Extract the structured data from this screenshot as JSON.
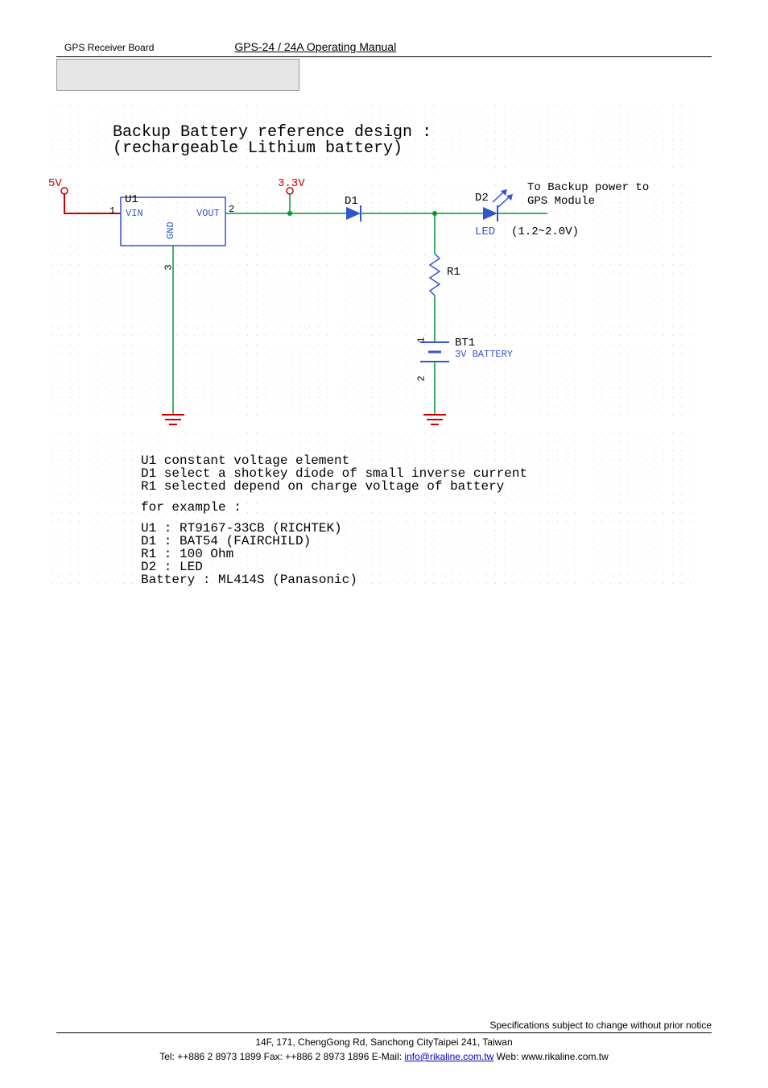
{
  "header": {
    "left": "GPS Receiver Board",
    "center": "GPS-24 / 24A Operating Manual"
  },
  "schematic": {
    "title1": "Backup Battery reference design :",
    "title2": "(rechargeable Lithium battery)",
    "v5": "5V",
    "v33": "3.3V",
    "U1": "U1",
    "VIN": "VIN",
    "VOUT": "VOUT",
    "GND": "GND",
    "pin1": "1",
    "pin2": "2",
    "pin3": "3",
    "D1": "D1",
    "D2": "D2",
    "LED": "LED",
    "ledv": "(1.2~2.0V)",
    "R1": "R1",
    "BT1": "BT1",
    "BT1desc": "3V BATTERY",
    "bt_pin1": "1",
    "bt_pin2": "2",
    "out1": "To Backup power to",
    "out2": "GPS Module",
    "notes_u1": "U1 constant voltage element",
    "notes_d1": "D1 select a shotkey diode of small inverse current",
    "notes_r1": "R1 selected depend on charge voltage of battery",
    "for_example": "for example :",
    "ex_u1": "U1 : RT9167-33CB (RICHTEK)",
    "ex_d1": "D1 : BAT54 (FAIRCHILD)",
    "ex_r1": "R1 : 100 Ohm",
    "ex_d2": "D2 : LED",
    "ex_batt": "Battery : ML414S (Panasonic)"
  },
  "footer": {
    "notice": "Specifications subject to change without prior notice",
    "addr": "14F, 171, ChengGong Rd, Sanchong CityTaipei 241, Taiwan",
    "tel": "Tel: ++886 2 8973 1899  Fax: ++886 2 8973 1896   E-Mail: ",
    "email": "info@rikaline.com.tw",
    "web": "    Web: www.rikaline.com.tw"
  }
}
